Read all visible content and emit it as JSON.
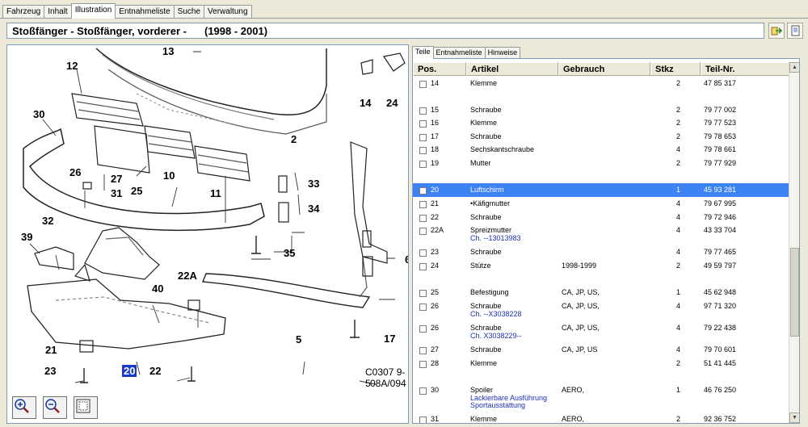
{
  "top_tabs": [
    {
      "label": "Fahrzeug"
    },
    {
      "label": "Inhalt"
    },
    {
      "label": "Illustration"
    },
    {
      "label": "Entnahmeliste"
    },
    {
      "label": "Suche"
    },
    {
      "label": "Verwaltung"
    }
  ],
  "header": {
    "title": "Stoßfänger - Stoßfänger, vorderer -",
    "years": "(1998 - 2001)"
  },
  "illustration": {
    "code_line1": "C0307 9-5",
    "code_line2": "08A/094",
    "callouts": [
      "12",
      "13",
      "14",
      "24",
      "30",
      "2",
      "26",
      "27",
      "10",
      "33",
      "31",
      "25",
      "11",
      "34",
      "32",
      "39",
      "35",
      "6",
      "40",
      "22A",
      "21",
      "5",
      "17",
      "23",
      "20",
      "22"
    ],
    "selected_callout": "20"
  },
  "right_tabs": [
    {
      "label": "Teile"
    },
    {
      "label": "Entnahmeliste"
    },
    {
      "label": "Hinweise"
    }
  ],
  "table": {
    "headers": {
      "pos": "Pos.",
      "artikel": "Artikel",
      "gebrauch": "Gebrauch",
      "stkz": "Stkz",
      "teil_nr": "Teil-Nr."
    },
    "rows": [
      {
        "pos": "14",
        "artikel": "Klemme",
        "gebrauch": "",
        "stkz": "2",
        "teil_nr": "47 85 317"
      },
      {
        "pos": "15",
        "artikel": "Schraube",
        "gebrauch": "",
        "stkz": "2",
        "teil_nr": "79 77 002"
      },
      {
        "pos": "16",
        "artikel": "Klemme",
        "gebrauch": "",
        "stkz": "2",
        "teil_nr": "79 77 523"
      },
      {
        "pos": "17",
        "artikel": "Schraube",
        "gebrauch": "",
        "stkz": "2",
        "teil_nr": "79 78 653"
      },
      {
        "pos": "18",
        "artikel": "Sechskantschraube",
        "gebrauch": "",
        "stkz": "4",
        "teil_nr": "79 78 661"
      },
      {
        "pos": "19",
        "artikel": "Mutter",
        "gebrauch": "",
        "stkz": "2",
        "teil_nr": "79 77 929"
      },
      {
        "pos": "20",
        "artikel": "Luftschirm",
        "gebrauch": "",
        "stkz": "1",
        "teil_nr": "45 93 281"
      },
      {
        "pos": "21",
        "artikel": "•Käfigmutter",
        "gebrauch": "",
        "stkz": "4",
        "teil_nr": "79 67 995"
      },
      {
        "pos": "22",
        "artikel": "Schraube",
        "gebrauch": "",
        "stkz": "4",
        "teil_nr": "79 72 946"
      },
      {
        "pos": "22A",
        "artikel": "Spreizmutter",
        "note": "Ch. --13013983",
        "gebrauch": "",
        "stkz": "4",
        "teil_nr": "43 33 704"
      },
      {
        "pos": "23",
        "artikel": "Schraube",
        "gebrauch": "",
        "stkz": "4",
        "teil_nr": "79 77 465"
      },
      {
        "pos": "24",
        "artikel": "Stütze",
        "gebrauch": "1998-1999",
        "stkz": "2",
        "teil_nr": "49 59 797"
      },
      {
        "pos": "25",
        "artikel": "Befestigung",
        "gebrauch": "CA, JP, US,",
        "stkz": "1",
        "teil_nr": "45 62 948"
      },
      {
        "pos": "26",
        "artikel": "Schraube",
        "note": "Ch. --X3038228",
        "gebrauch": "CA, JP, US,",
        "stkz": "4",
        "teil_nr": "97 71 320"
      },
      {
        "pos": "26",
        "artikel": "Schraube",
        "note": "Ch. X3038229--",
        "gebrauch": "CA, JP, US,",
        "stkz": "4",
        "teil_nr": "79 22 438"
      },
      {
        "pos": "27",
        "artikel": "Schraube",
        "gebrauch": "CA, JP, US",
        "stkz": "4",
        "teil_nr": "79 70 601"
      },
      {
        "pos": "28",
        "artikel": "Klemme",
        "gebrauch": "",
        "stkz": "2",
        "teil_nr": "51 41 445"
      },
      {
        "pos": "30",
        "artikel": "Spoiler",
        "note": "Lackierbare Ausführung",
        "note2": "Sportausstattung",
        "gebrauch": "AERO,",
        "stkz": "1",
        "teil_nr": "46 76 250"
      },
      {
        "pos": "31",
        "artikel": "Klemme",
        "gebrauch": "AERO,",
        "stkz": "2",
        "teil_nr": "92 36 752"
      }
    ]
  },
  "colors": {
    "selection": "#3d83f3",
    "callout_selection": "#1a39c8",
    "note_blue": "#1a2fb0"
  }
}
